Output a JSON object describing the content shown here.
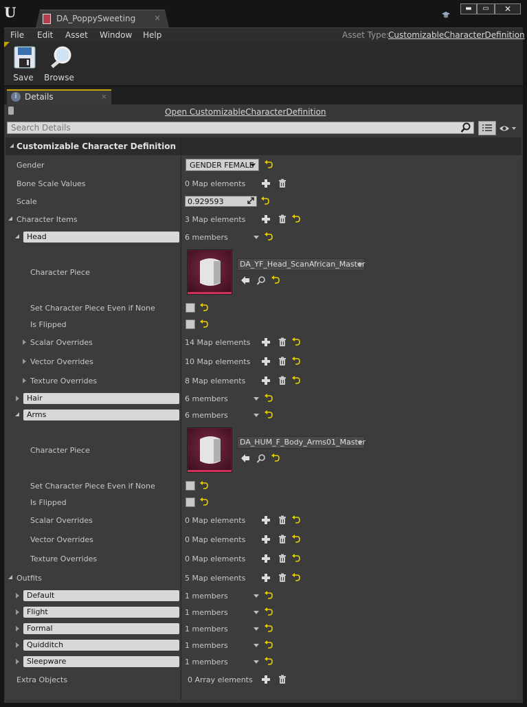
{
  "window": {
    "tab_title": "DA_PoppySweeting",
    "tab_close": "×",
    "min": "▬",
    "max": "▭",
    "close": "✕"
  },
  "menu": {
    "items": [
      "File",
      "Edit",
      "Asset",
      "Window",
      "Help"
    ],
    "asset_type_label": "Asset Type:",
    "asset_type_value": "CustomizableCharacterDefinition"
  },
  "toolbar": {
    "save": "Save",
    "browse": "Browse"
  },
  "details": {
    "tab_label": "Details",
    "tab_close": "×",
    "open_link": "Open CustomizableCharacterDefinition",
    "search_placeholder": "Search Details",
    "category": "Customizable Character Definition"
  },
  "props": {
    "gender": {
      "label": "Gender",
      "value": "GENDER FEMALE"
    },
    "bone_scale": {
      "label": "Bone Scale Values",
      "value": "0 Map elements"
    },
    "scale": {
      "label": "Scale",
      "value": "0.929593"
    },
    "character_items": {
      "label": "Character Items",
      "value": "3 Map elements"
    },
    "head": {
      "key": "Head",
      "value": "6 members",
      "piece_label": "Character Piece",
      "piece_value": "DA_YF_Head_ScanAfrican_Master",
      "set_none_label": "Set Character Piece Even if None",
      "flipped_label": "Is Flipped",
      "scalar": {
        "label": "Scalar Overrides",
        "value": "14 Map elements"
      },
      "vector": {
        "label": "Vector Overrides",
        "value": "10 Map elements"
      },
      "texture": {
        "label": "Texture Overrides",
        "value": "8 Map elements"
      }
    },
    "hair": {
      "key": "Hair",
      "value": "6 members"
    },
    "arms": {
      "key": "Arms",
      "value": "6 members",
      "piece_label": "Character Piece",
      "piece_value": "DA_HUM_F_Body_Arms01_Master",
      "set_none_label": "Set Character Piece Even if None",
      "flipped_label": "Is Flipped",
      "scalar": {
        "label": "Scalar Overrides",
        "value": "0 Map elements"
      },
      "vector": {
        "label": "Vector Overrides",
        "value": "0 Map elements"
      },
      "texture": {
        "label": "Texture Overrides",
        "value": "0 Map elements"
      }
    },
    "outfits": {
      "label": "Outfits",
      "value": "5 Map elements",
      "items": [
        {
          "key": "Default",
          "value": "1 members"
        },
        {
          "key": "Flight",
          "value": "1 members"
        },
        {
          "key": "Formal",
          "value": "1 members"
        },
        {
          "key": "Quidditch",
          "value": "1 members"
        },
        {
          "key": "Sleepware",
          "value": "1 members"
        }
      ]
    },
    "extra_objects": {
      "label": "Extra Objects",
      "value": "0 Array elements"
    }
  },
  "colors": {
    "accent": "#c8a000",
    "reset_arrow": "#e8d000",
    "thumb_bar": "#d0305a"
  }
}
